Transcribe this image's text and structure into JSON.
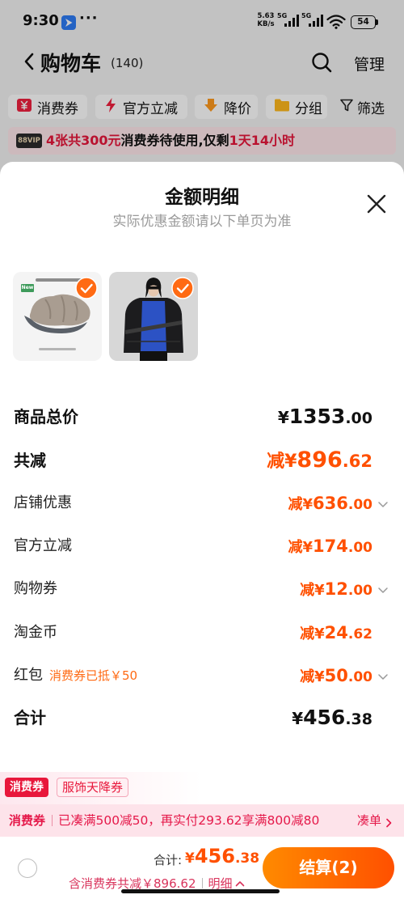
{
  "status_bar": {
    "time": "9:30",
    "more": "···",
    "speed_value": "5.63",
    "speed_unit": "KB/s",
    "network_1": "5G",
    "network_2": "5G",
    "battery_level": "54"
  },
  "header": {
    "title": "购物车",
    "count": "(140)",
    "manage": "管理"
  },
  "filters": [
    {
      "label": "消费券",
      "icon": "coupon-icon"
    },
    {
      "label": "官方立减",
      "icon": "lightning-icon"
    },
    {
      "label": "降价",
      "icon": "price-drop-icon"
    },
    {
      "label": "分组",
      "icon": "folder-icon"
    },
    {
      "label": "筛选",
      "icon": "filter-icon"
    }
  ],
  "vip_banner": {
    "badge": "88VIP",
    "count_text": "4张共300元",
    "middle_text": "消费券待使用,仅剩",
    "time_left": "1天14小时"
  },
  "sheet": {
    "title": "金额明细",
    "subtitle": "实际优惠金额请以下单页为准",
    "products": [
      {
        "badge": "New",
        "selected": true
      },
      {
        "selected": true
      }
    ],
    "rows": [
      {
        "label": "商品总价",
        "currency": "¥",
        "integer": "1353",
        "decimal": ".00",
        "expandable": false
      },
      {
        "label": "共减",
        "prefix": "减",
        "currency": "¥",
        "integer": "896",
        "decimal": ".62",
        "expandable": false
      },
      {
        "label": "店铺优惠",
        "prefix": "减",
        "currency": "¥",
        "integer": "636",
        "decimal": ".00",
        "expandable": true
      },
      {
        "label": "官方立减",
        "prefix": "减",
        "currency": "¥",
        "integer": "174",
        "decimal": ".00",
        "expandable": false
      },
      {
        "label": "购物券",
        "prefix": "减",
        "currency": "¥",
        "integer": "12",
        "decimal": ".00",
        "expandable": true
      },
      {
        "label": "淘金币",
        "prefix": "减",
        "currency": "¥",
        "integer": "24",
        "decimal": ".62",
        "expandable": false
      },
      {
        "label": "红包",
        "note": "消费券已抵￥50",
        "prefix": "减",
        "currency": "¥",
        "integer": "50",
        "decimal": ".00",
        "expandable": true
      },
      {
        "label": "合计",
        "currency": "¥",
        "integer": "456",
        "decimal": ".38",
        "expandable": false
      }
    ]
  },
  "coupon_tags": [
    "消费券",
    "服饰天降券"
  ],
  "promo_bar": {
    "tag": "消费券",
    "text": "已凑满500减50，再实付293.62享满800减80",
    "action": "凑单"
  },
  "checkout": {
    "total_label": "合计:",
    "currency": "¥",
    "total_integer": "456",
    "total_decimal": ".38",
    "discount_text": "含消费券共减￥896.62",
    "detail_label": "明细",
    "button_label": "结算(2)"
  },
  "colors": {
    "accent_orange": "#FF5000",
    "coupon_red": "#E8173B",
    "promo_bg": "#FDE3EA",
    "check_orange": "#FF6A13",
    "button_gradient": [
      "#FF8A00",
      "#FF5000"
    ]
  }
}
